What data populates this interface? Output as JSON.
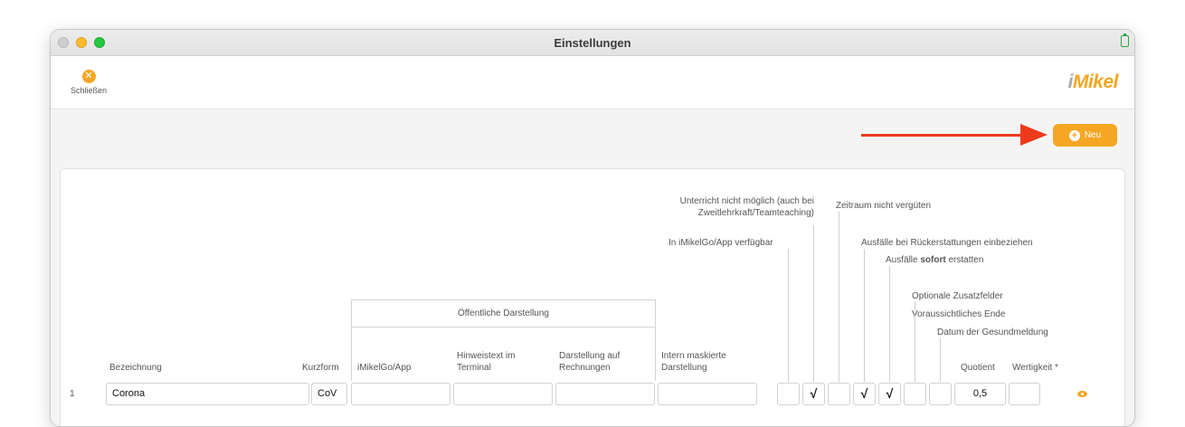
{
  "window": {
    "title": "Einstellungen"
  },
  "toolbar": {
    "close_label": "Schließen",
    "logo_i": "i",
    "logo_rest": "Mikel"
  },
  "actions": {
    "new_label": "Neu"
  },
  "group_header": "Öffentliche Darstellung",
  "columns": {
    "bezeichnung": "Bezeichnung",
    "kurzform": "Kurzform",
    "imikelgo_app": "iMikelGo/App",
    "hinweistext_1": "Hinweistext im",
    "hinweistext_2": "Terminal",
    "rechnungen_1": "Darstellung auf",
    "rechnungen_2": "Rechnungen",
    "intern_1": "Intern maskierte",
    "intern_2": "Darstellung",
    "quotient": "Quotient",
    "wertigkeit": "Wertigkeit *"
  },
  "flag_headers": {
    "unterricht_1": "Unterricht nicht möglich (auch bei",
    "unterricht_2": "Zweitlehrkraft/Teamteaching)",
    "app_verfuegbar": "In iMikelGo/App verfügbar",
    "zeitraum": "Zeitraum nicht vergüten",
    "rueckerstattungen": "Ausfälle bei Rückerstattungen einbeziehen",
    "sofort_pre": "Ausfälle ",
    "sofort_bold": "sofort",
    "sofort_post": " erstatten",
    "zusatzfelder": "Optionale Zusatzfelder",
    "ende": "Voraussichtliches Ende",
    "gesundmeldung": "Datum der Gesundmeldung"
  },
  "rows": [
    {
      "number": "1",
      "bezeichnung": "Corona",
      "kurzform": "CoV",
      "imikelgo_app": "",
      "hinweistext": "",
      "rechnungen": "",
      "intern": "",
      "flags": [
        "",
        "√",
        "",
        "√",
        "√",
        "",
        ""
      ],
      "quotient": "0,5",
      "wertigkeit": ""
    }
  ],
  "colors": {
    "accent": "#f5a623",
    "arrow": "#ee3a1c"
  }
}
